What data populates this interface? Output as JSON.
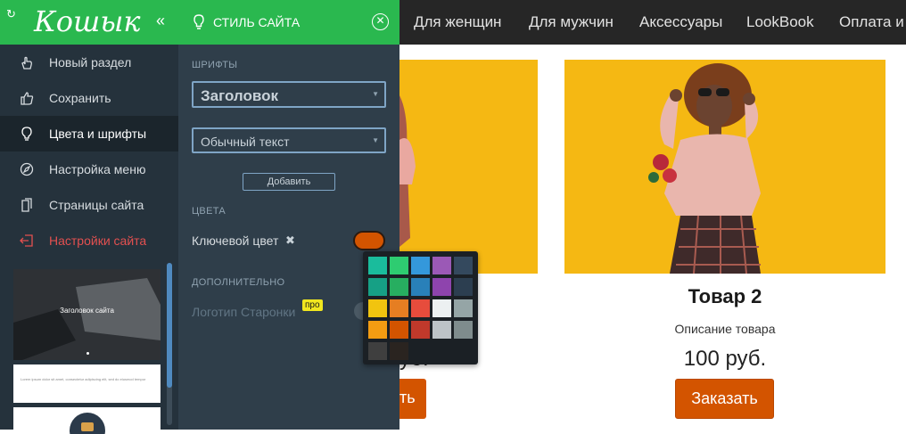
{
  "topnav": {
    "items": [
      "Для женщин",
      "Для мужчин",
      "Аксессуары",
      "LookBook",
      "Оплата и"
    ]
  },
  "sidebar": {
    "logo": "Кошык",
    "collapse_icon": "double-chevron-left-icon",
    "items": [
      {
        "label": "Новый раздел",
        "icon": "hand-pointer-icon"
      },
      {
        "label": "Сохранить",
        "icon": "thumbs-up-icon"
      },
      {
        "label": "Цвета и шрифты",
        "icon": "lightbulb-icon"
      },
      {
        "label": "Настройка меню",
        "icon": "compass-icon"
      },
      {
        "label": "Страницы сайта",
        "icon": "pages-icon"
      },
      {
        "label": "Настройки сайта",
        "icon": "sign-out-icon"
      }
    ],
    "thumbs": {
      "hero_title": "Заголовок сайта",
      "text_line": "Lorem ipsum dolor sit amet, consectetur adipiscing elit, sed do eiusmod tempor"
    }
  },
  "panel": {
    "title": "СТИЛЬ САЙТА",
    "fonts_section": "ШРИФТЫ",
    "heading_font": "Заголовок",
    "body_font": "Обычный текст",
    "add_button": "Добавить",
    "colors_section": "ЦВЕТА",
    "key_color_label": "Ключевой цвет",
    "key_color_remove": "✖",
    "key_color": "#d35400",
    "extra_section": "ДОПОЛНИТЕЛЬНО",
    "logo_label": "Логотип Старонки",
    "pro_badge": "про"
  },
  "palette": {
    "colors": [
      "#1abc9c",
      "#2ecc71",
      "#3498db",
      "#9b59b6",
      "#34495e",
      "#16a085",
      "#27ae60",
      "#2980b9",
      "#8e44ad",
      "#2c3e50",
      "#f1c40f",
      "#e67e22",
      "#e74c3c",
      "#ecf0f1",
      "#95a5a6",
      "#f39c12",
      "#d35400",
      "#c0392b",
      "#bdc3c7",
      "#7f8c8d",
      "#3f3f3f",
      "#2a2420"
    ]
  },
  "product": {
    "title": "Товар 2",
    "description": "Описание товара",
    "price": "100 руб.",
    "price_partial": "уб.",
    "order_button": "Заказать",
    "order_button_partial": "ть"
  }
}
